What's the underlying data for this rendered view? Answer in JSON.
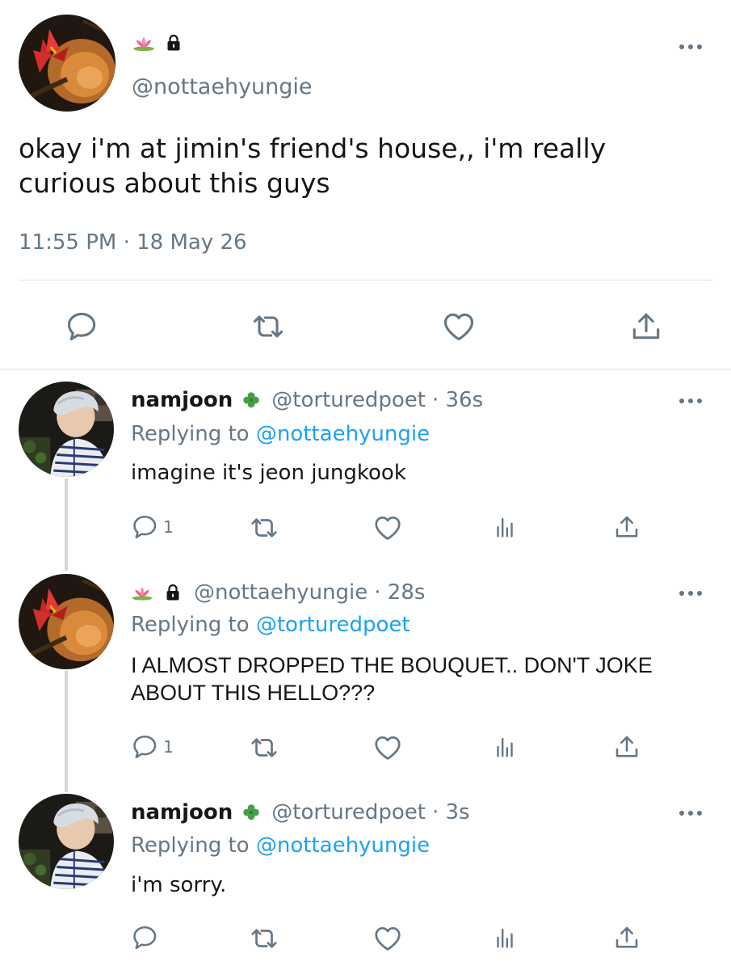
{
  "main_tweet": {
    "badges": [
      "lotus",
      "lock"
    ],
    "handle": "@nottaehyungie",
    "text": "okay i'm at jimin's friend's house,, i'm really curious about this guys",
    "timestamp": "11:55 PM · 18 May 26"
  },
  "replies": [
    {
      "name": "namjoon",
      "name_emoji": "🍀",
      "handle": "@torturedpoet",
      "time": "· 36s",
      "replying_prefix": "Replying to",
      "replying_to": "@nottaehyungie",
      "text": "imagine it's jeon jungkook",
      "reply_count": "1"
    },
    {
      "badges": [
        "lotus",
        "lock"
      ],
      "handle": "@nottaehyungie",
      "time": "· 28s",
      "replying_prefix": "Replying to",
      "replying_to": "@torturedpoet",
      "text": "I ALMOST DROPPED THE BOUQUET.. DON'T JOKE ABOUT THIS HELLO???",
      "reply_count": "1"
    },
    {
      "name": "namjoon",
      "name_emoji": "🍀",
      "handle": "@torturedpoet",
      "time": "· 3s",
      "replying_prefix": "Replying to",
      "replying_to": "@nottaehyungie",
      "text": "i'm sorry.",
      "reply_count": ""
    }
  ],
  "colors": {
    "text": "#14171a",
    "secondary": "#657786",
    "link": "#1da1f2",
    "divider": "#e6ecf0"
  },
  "icons": [
    "reply-icon",
    "retweet-icon",
    "like-icon",
    "analytics-icon",
    "share-icon",
    "more-icon",
    "lock-icon",
    "lotus-icon",
    "clover-icon"
  ]
}
